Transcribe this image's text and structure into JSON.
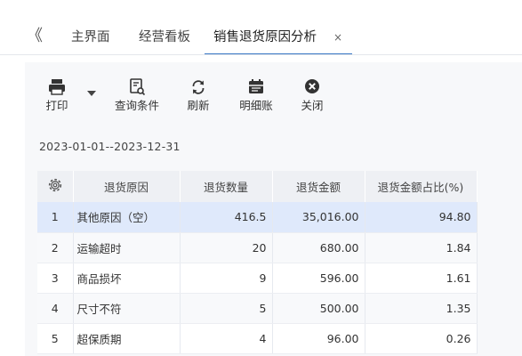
{
  "tabs": {
    "collapse_glyph": "《",
    "items": [
      {
        "label": "主界面"
      },
      {
        "label": "经营看板"
      },
      {
        "label": "销售退货原因分析",
        "active": true
      }
    ],
    "close_glyph": "×"
  },
  "toolbar": {
    "print": {
      "label": "打印",
      "icon": "printer-icon"
    },
    "query": {
      "label": "查询条件",
      "icon": "query-conditions-icon"
    },
    "refresh": {
      "label": "刷新",
      "icon": "refresh-icon"
    },
    "detail": {
      "label": "明细账",
      "icon": "ledger-icon"
    },
    "close": {
      "label": "关闭",
      "icon": "close-circle-icon"
    }
  },
  "filter": {
    "date_range": "2023-01-01--2023-12-31"
  },
  "table": {
    "columns": [
      "退货原因",
      "退货数量",
      "退货金额",
      "退货金额占比(%)"
    ],
    "rows": [
      {
        "no": "1",
        "reason": "其他原因（空）",
        "qty": "416.5",
        "amount": "35,016.00",
        "ratio": "94.80"
      },
      {
        "no": "2",
        "reason": "运输超时",
        "qty": "20",
        "amount": "680.00",
        "ratio": "1.84"
      },
      {
        "no": "3",
        "reason": "商品损坏",
        "qty": "9",
        "amount": "596.00",
        "ratio": "1.61"
      },
      {
        "no": "4",
        "reason": "尺寸不符",
        "qty": "5",
        "amount": "500.00",
        "ratio": "1.35"
      },
      {
        "no": "5",
        "reason": "超保质期",
        "qty": "4",
        "amount": "96.00",
        "ratio": "0.26"
      }
    ]
  },
  "colors": {
    "active_tab_underline": "#3a78c6",
    "selected_row": "#dfe9fb",
    "header_bg": "#eef0f4"
  }
}
